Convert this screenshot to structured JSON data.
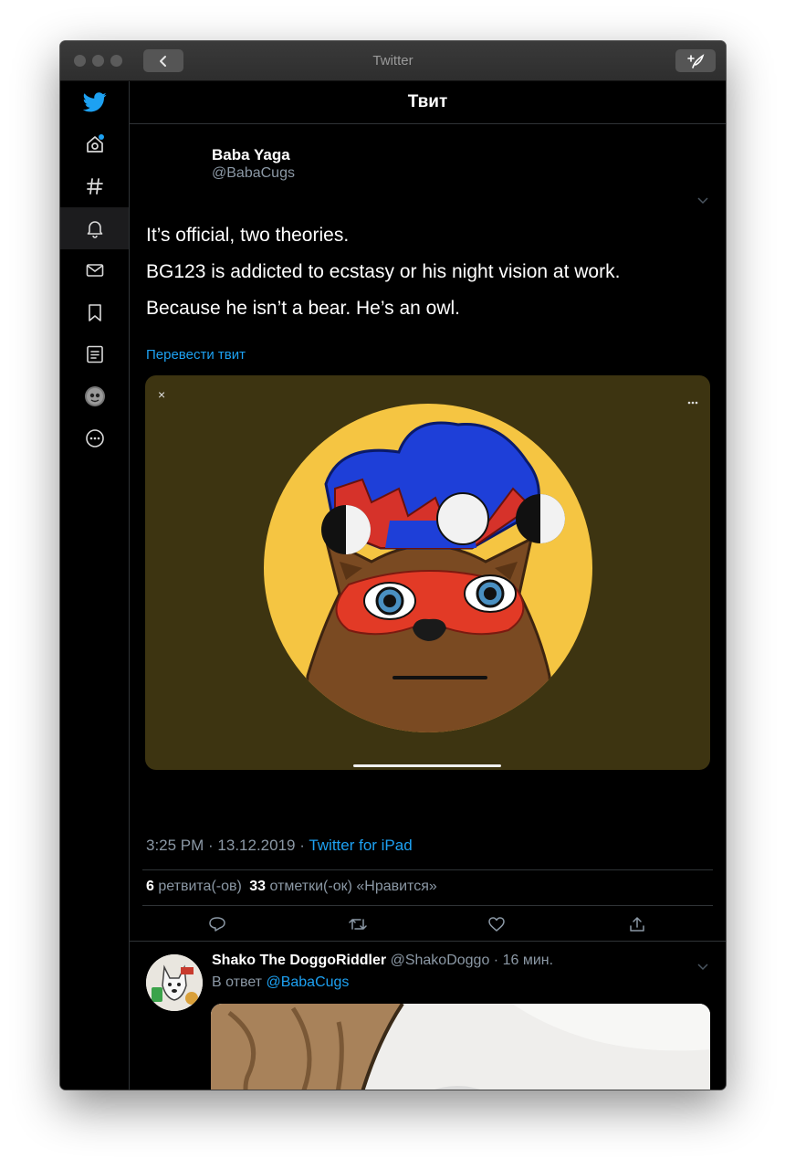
{
  "window": {
    "title": "Twitter"
  },
  "header": {
    "title": "Твит"
  },
  "tweet": {
    "author_name": "Baba Yaga",
    "author_handle": "@BabaCugs",
    "lines": [
      "It’s official, two theories.",
      "BG123 is addicted to ecstasy or his night vision at work.",
      "Because he isn’t a bear. He’s an owl."
    ],
    "translate": "Перевести твит",
    "time": "3:25 PM · 13.12.2019 · ",
    "source": "Twitter for iPad",
    "retweet_count": "6",
    "retweet_label": "ретвита(-ов)",
    "like_count": "33",
    "like_label": "отметки(-ок) «Нравится»"
  },
  "reply": {
    "author_name": "Shako The DoggoRiddler",
    "author_handle": "@ShakoDoggo",
    "time": "· 16 мин.",
    "reply_to_label": "В ответ",
    "reply_to_handle": "@BabaCugs"
  },
  "colors": {
    "accent": "#1da1f2",
    "media_bg": "#3d3411",
    "avatar_yellow": "#f5c542"
  },
  "icons": [
    "twitter-logo-icon",
    "home-icon",
    "hashtag-icon",
    "bell-icon",
    "mail-icon",
    "bookmark-icon",
    "list-icon",
    "more-icon",
    "reply-icon",
    "retweet-icon",
    "like-icon",
    "share-icon",
    "compose-icon",
    "back-icon"
  ]
}
